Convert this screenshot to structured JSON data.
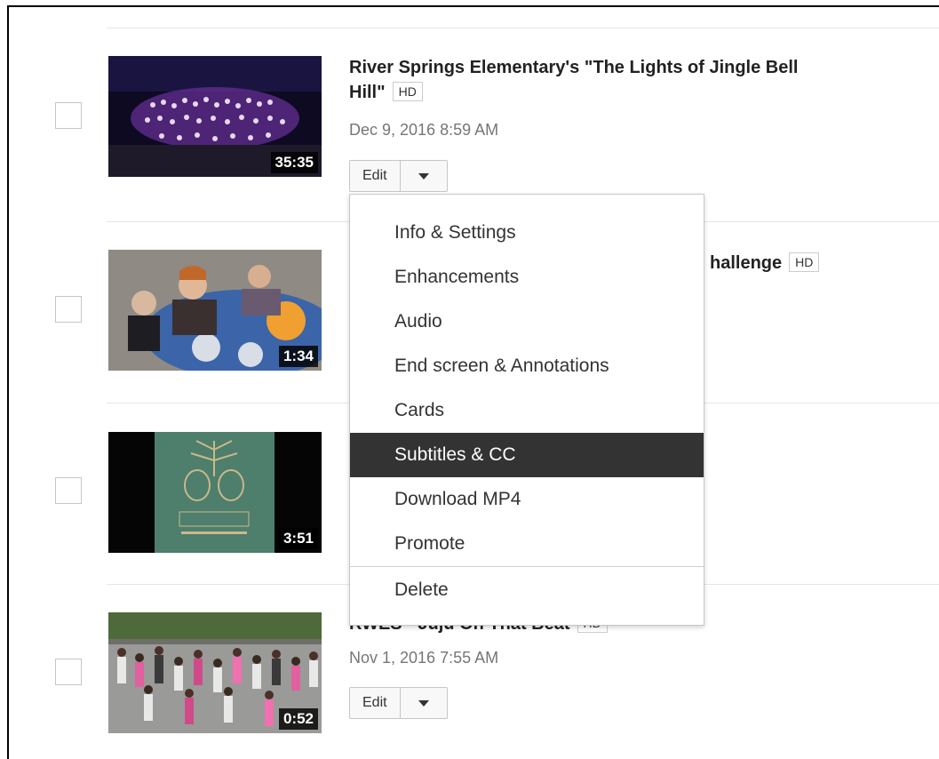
{
  "videos": [
    {
      "title_line1": "River Springs Elementary's \"The Lights of Jingle Bell",
      "title_line2": "Hill\"",
      "hd": "HD",
      "date": "Dec 9, 2016 8:59 AM",
      "duration": "35:35",
      "edit_label": "Edit"
    },
    {
      "title_partial": "hallenge",
      "hd": "HD",
      "duration": "1:34"
    },
    {
      "duration": "3:51"
    },
    {
      "title_partial": "RWES - Juju On That Beat",
      "hd": "HD",
      "date": "Nov 1, 2016 7:55 AM",
      "duration": "0:52",
      "edit_label": "Edit"
    }
  ],
  "dropdown": {
    "items": [
      "Info & Settings",
      "Enhancements",
      "Audio",
      "End screen & Annotations",
      "Cards",
      "Subtitles & CC",
      "Download MP4",
      "Promote",
      "Delete"
    ],
    "active_item": "Subtitles & CC"
  },
  "icons": {
    "dropdown_toggle": "chevron-down-icon"
  },
  "colors": {
    "active_bg": "#333333",
    "date_text": "#767676"
  }
}
